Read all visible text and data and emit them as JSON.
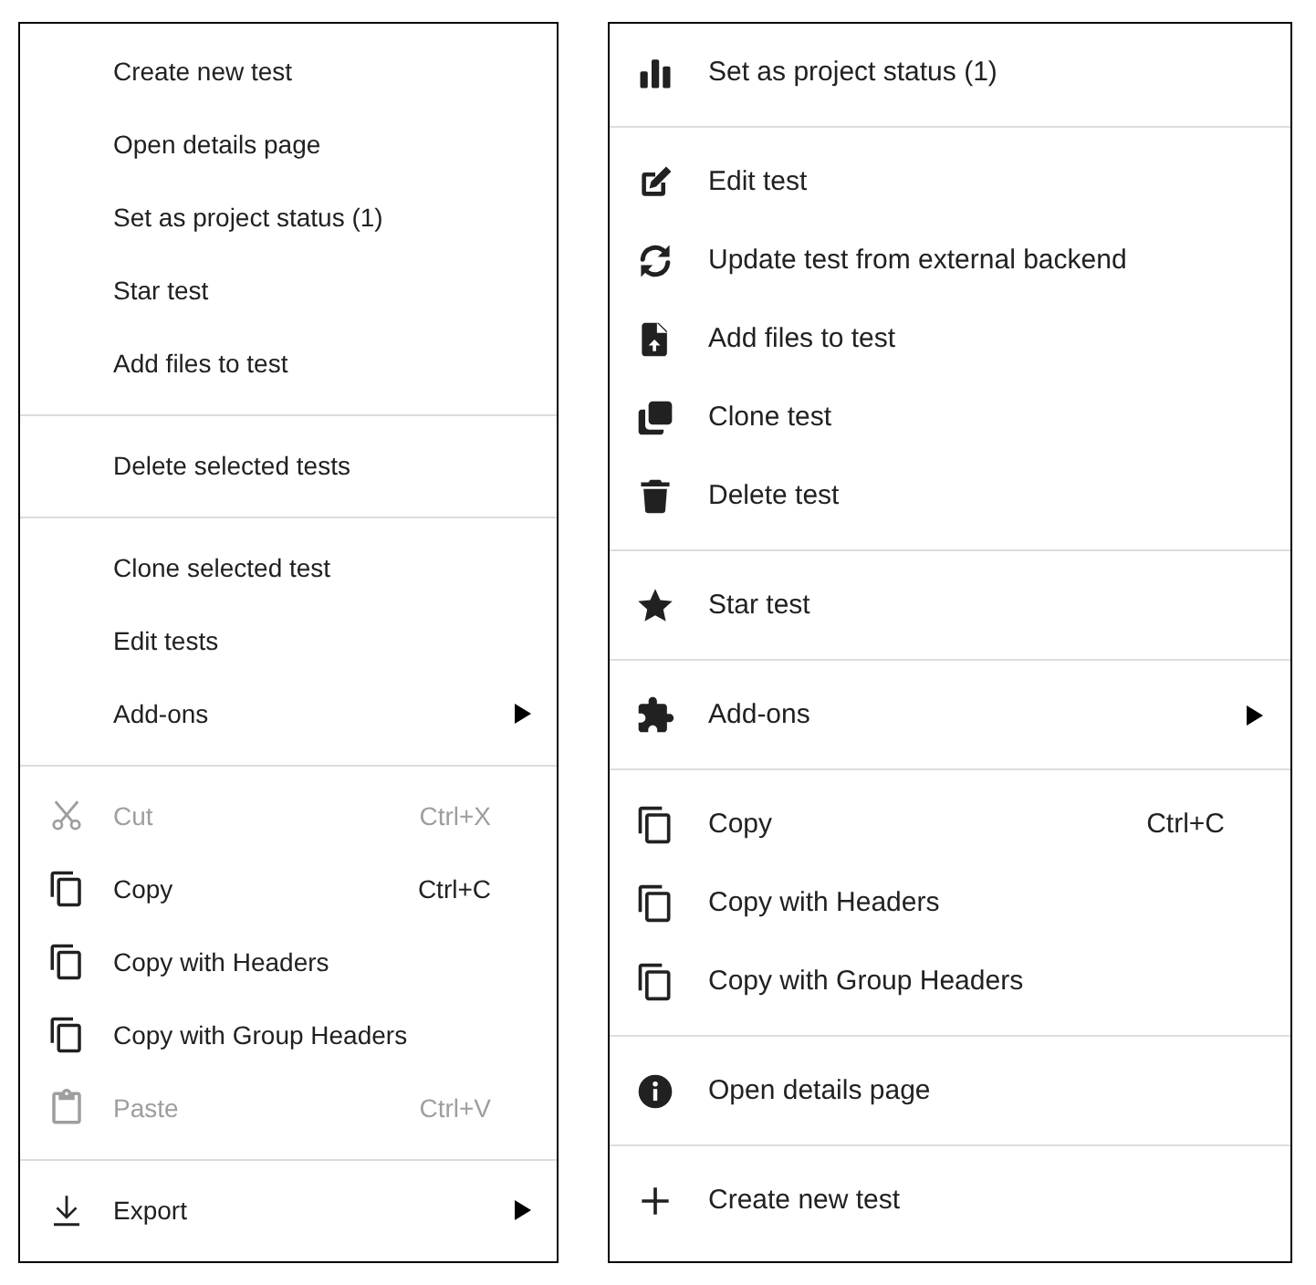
{
  "menus": [
    {
      "groups": [
        {
          "items": [
            {
              "label": "Create new test",
              "kind": "none",
              "disabled": false,
              "submenu": false
            },
            {
              "label": "Open details page",
              "kind": "none",
              "disabled": false,
              "submenu": false
            },
            {
              "label": "Set as project status (1)",
              "kind": "none",
              "disabled": false,
              "submenu": false
            },
            {
              "label": "Star test",
              "kind": "none",
              "disabled": false,
              "submenu": false
            },
            {
              "label": "Add files to test",
              "kind": "none",
              "disabled": false,
              "submenu": false
            }
          ]
        },
        {
          "items": [
            {
              "label": "Delete selected tests",
              "kind": "none",
              "disabled": false,
              "submenu": false
            }
          ]
        },
        {
          "items": [
            {
              "label": "Clone selected test",
              "kind": "none",
              "disabled": false,
              "submenu": false
            },
            {
              "label": "Edit tests",
              "kind": "none",
              "disabled": false,
              "submenu": false
            },
            {
              "label": "Add-ons",
              "kind": "none",
              "disabled": false,
              "submenu": true
            }
          ]
        },
        {
          "items": [
            {
              "label": "Cut",
              "kind": "cut",
              "shortcut": "Ctrl+X",
              "disabled": true,
              "submenu": false
            },
            {
              "label": "Copy",
              "kind": "copy",
              "shortcut": "Ctrl+C",
              "disabled": false,
              "submenu": false
            },
            {
              "label": "Copy with Headers",
              "kind": "copy",
              "disabled": false,
              "submenu": false
            },
            {
              "label": "Copy with Group Headers",
              "kind": "copy",
              "disabled": false,
              "submenu": false
            },
            {
              "label": "Paste",
              "kind": "paste",
              "shortcut": "Ctrl+V",
              "disabled": true,
              "submenu": false
            }
          ]
        },
        {
          "items": [
            {
              "label": "Export",
              "kind": "download",
              "disabled": false,
              "submenu": true
            }
          ]
        }
      ]
    },
    {
      "groups": [
        {
          "items": [
            {
              "label": "Set as project status (1)",
              "kind": "bars",
              "submenu": false
            }
          ]
        },
        {
          "items": [
            {
              "label": "Edit test",
              "kind": "edit",
              "submenu": false
            },
            {
              "label": "Update test from external backend",
              "kind": "sync",
              "submenu": false
            },
            {
              "label": "Add files to test",
              "kind": "file-upload",
              "submenu": false
            },
            {
              "label": "Clone test",
              "kind": "clone",
              "submenu": false
            },
            {
              "label": "Delete test",
              "kind": "trash",
              "submenu": false
            }
          ]
        },
        {
          "items": [
            {
              "label": "Star test",
              "kind": "star",
              "submenu": false
            }
          ]
        },
        {
          "items": [
            {
              "label": "Add-ons",
              "kind": "puzzle",
              "submenu": true
            }
          ]
        },
        {
          "items": [
            {
              "label": "Copy",
              "kind": "copy",
              "shortcut": "Ctrl+C",
              "submenu": false
            },
            {
              "label": "Copy with Headers",
              "kind": "copy",
              "submenu": false
            },
            {
              "label": "Copy with Group Headers",
              "kind": "copy",
              "submenu": false
            }
          ]
        },
        {
          "items": [
            {
              "label": "Open details page",
              "kind": "info",
              "submenu": false
            }
          ]
        },
        {
          "items": [
            {
              "label": "Create new test",
              "kind": "plus",
              "submenu": false
            }
          ]
        }
      ]
    }
  ]
}
